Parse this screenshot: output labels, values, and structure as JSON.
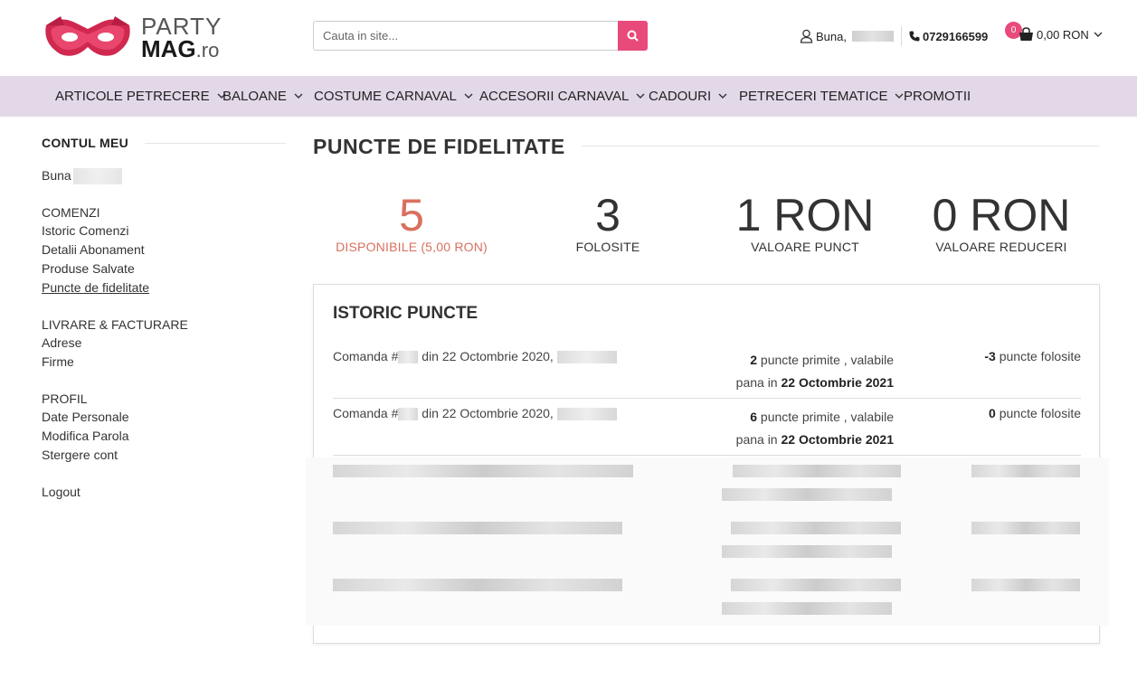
{
  "brand": {
    "party": "PARTY",
    "mag": "MAG",
    "tld": ".ro"
  },
  "search": {
    "placeholder": "Cauta in site..."
  },
  "header": {
    "greeting": "Buna,",
    "phone": "0729166599",
    "cart_total": "0,00 RON",
    "cart_count": "0"
  },
  "nav": {
    "items": [
      {
        "label": "ARTICOLE PETRECERE",
        "has_dropdown": true
      },
      {
        "label": "BALOANE",
        "has_dropdown": true
      },
      {
        "label": "COSTUME CARNAVAL",
        "has_dropdown": true
      },
      {
        "label": "ACCESORII CARNAVAL",
        "has_dropdown": true
      },
      {
        "label": "CADOURI",
        "has_dropdown": true
      },
      {
        "label": "PETRECERI TEMATICE",
        "has_dropdown": true
      },
      {
        "label": "PROMOTII",
        "has_dropdown": false
      }
    ]
  },
  "sidebar": {
    "title": "CONTUL MEU",
    "greeting": "Buna",
    "sections": {
      "orders": "COMENZI",
      "order_history": "Istoric Comenzi",
      "subscription": "Detalii Abonament",
      "saved_products": "Produse Salvate",
      "loyalty_points": "Puncte de fidelitate",
      "shipping": "LIVRARE & FACTURARE",
      "addresses": "Adrese",
      "companies": "Firme",
      "profile": "PROFIL",
      "personal_data": "Date Personale",
      "change_password": "Modifica Parola",
      "delete_account": "Stergere cont",
      "logout": "Logout"
    }
  },
  "main": {
    "title": "PUNCTE DE FIDELITATE",
    "stats": [
      {
        "value": "5",
        "label": "DISPONIBILE (5,00 RON)"
      },
      {
        "value": "3",
        "label": "FOLOSITE"
      },
      {
        "value": "1 RON",
        "label": "VALOARE PUNCT"
      },
      {
        "value": "0 RON",
        "label": "VALOARE REDUCERI"
      }
    ],
    "history": {
      "title": "ISTORIC PUNCTE",
      "rows": [
        {
          "order_prefix": "Comanda #",
          "order_suffix": "din 22 Octombrie 2020,",
          "received": "2",
          "received_text": " puncte primite , valabile",
          "valid_prefix": "pana in ",
          "valid_date": "22 Octombrie 2021",
          "used": "-3",
          "used_text": " puncte folosite"
        },
        {
          "order_prefix": "Comanda #",
          "order_suffix": "din 22 Octombrie 2020,",
          "received": "6",
          "received_text": " puncte primite , valabile",
          "valid_prefix": "pana in ",
          "valid_date": "22 Octombrie 2021",
          "used": "0",
          "used_text": " puncte folosite"
        }
      ]
    }
  },
  "colors": {
    "accent_pink": "#e84a7a",
    "nav_bg": "#e3d8e8",
    "highlight": "#d9705e"
  }
}
